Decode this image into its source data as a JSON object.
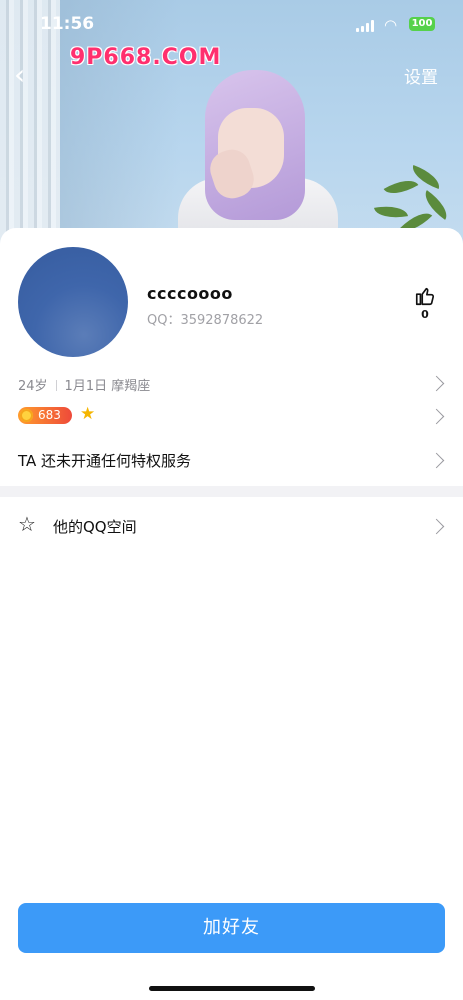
{
  "status_bar": {
    "time": "11:56",
    "battery": "100"
  },
  "header": {
    "settings_label": "设置",
    "watermark": "9P668.COM"
  },
  "profile": {
    "nickname": "ccccoooo",
    "qq_label": "QQ：3592878622",
    "like_count": "0",
    "age": "24岁",
    "birthday": "1月1日",
    "zodiac": "摩羯座",
    "level": "683"
  },
  "privilege": {
    "text": "TA 还未开通任何特权服务"
  },
  "qzone": {
    "label": "他的QQ空间"
  },
  "actions": {
    "add_friend_label": "加好友"
  },
  "colors": {
    "primary": "#3c9af8",
    "level_badge": "#ee4a3a",
    "star": "#f5b500"
  },
  "icons": [
    "back-icon",
    "signal-icon",
    "wifi-icon",
    "battery-icon",
    "thumbs-up-icon",
    "coin-icon",
    "star-icon",
    "qzone-star-icon",
    "chevron-right-icon"
  ]
}
